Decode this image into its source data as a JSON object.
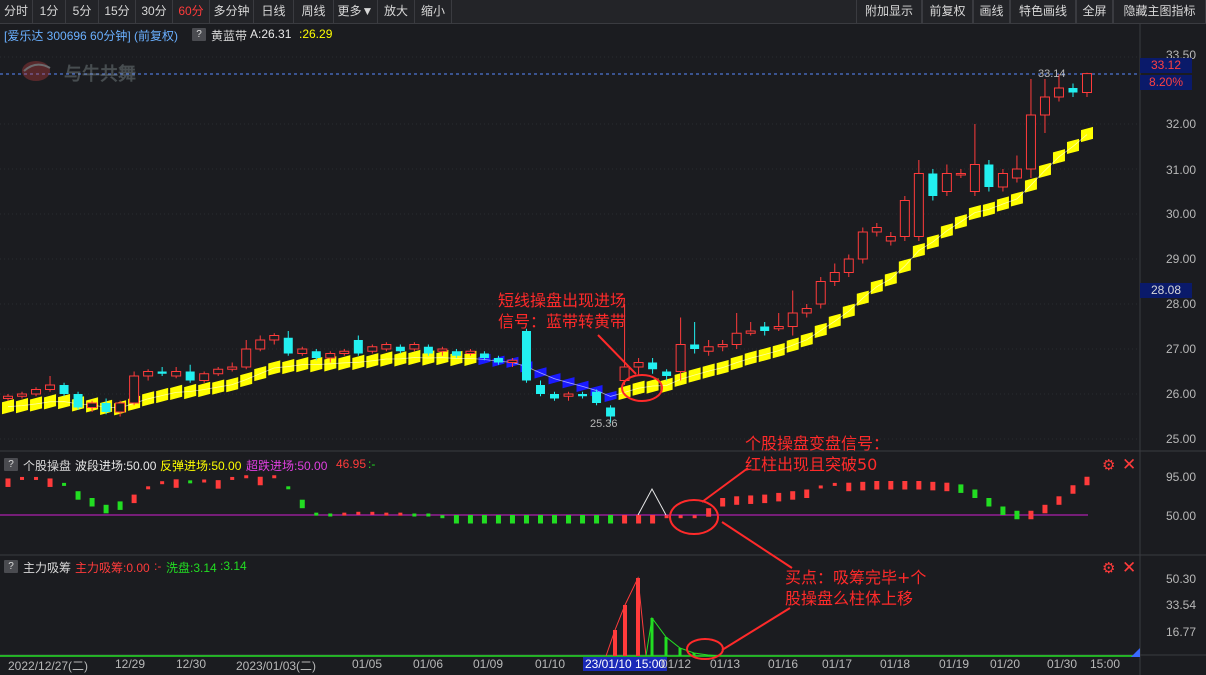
{
  "toolbar": {
    "left": [
      "分时",
      "1分",
      "5分",
      "15分",
      "30分",
      "60分",
      "多分钟",
      "日线",
      "周线",
      "更多▼",
      "放大",
      "缩小"
    ],
    "right": [
      "附加显示",
      "前复权",
      "画线",
      "特色画线",
      "全屏",
      "隐藏主图指标"
    ]
  },
  "main": {
    "title": "[爱乐达 300696 60分钟] (前复权)",
    "indicator_name": "黄蓝带",
    "indicator_a": "A:26.31",
    "indicator_b": ":26.29",
    "watermark": "与牛共舞",
    "price_axis": [
      "33.50",
      "32.00",
      "31.00",
      "30.00",
      "29.00",
      "28.00",
      "27.00",
      "26.00",
      "25.00"
    ],
    "current_price": "33.12",
    "current_pct": "8.20%",
    "ref_price": "28.08",
    "high_label": "33.14",
    "low_label": "25.36"
  },
  "sub1": {
    "name": "个股操盘",
    "v1": "波段进场:50.00",
    "v2": "反弹进场:50.00",
    "v3": "超跌进场:50.00",
    "v4": "46.95",
    "v5": ":-",
    "axis": [
      "95.00",
      "50.00"
    ]
  },
  "sub2": {
    "name": "主力吸筹",
    "v1": "主力吸筹:0.00",
    "v2": ":-",
    "v3": "洗盘:3.14",
    "v4": ":3.14",
    "axis": [
      "50.30",
      "33.54",
      "16.77"
    ]
  },
  "dates": [
    "2022/12/27(二)",
    "12/29",
    "12/30",
    "2023/01/03(二)",
    "01/05",
    "01/06",
    "01/09",
    "01/10",
    "23/01/10 15:00",
    "01/12",
    "01/13",
    "01/16",
    "01/17",
    "01/18",
    "01/19",
    "01/20",
    "01/30",
    "15:00"
  ],
  "annotations": {
    "a1_line1": "短线操盘出现进场",
    "a1_line2": "信号：蓝带转黄带",
    "a2_line1": "个股操盘变盘信号：",
    "a2_line2": "红柱出现且突破50",
    "a3_line1": "买点：吸筹完毕+个",
    "a3_line2": "股操盘么柱体上移"
  },
  "colors": {
    "up": "#ff3b3b",
    "down": "#22f0f0",
    "yellow": "#ffff00",
    "blue": "#1a1aff",
    "green": "#22dd22",
    "magenta": "#d020d0"
  },
  "chart_data": {
    "type": "candlestick",
    "series": [
      {
        "name": "K线",
        "ohlc": [
          [
            25.9,
            25.95,
            25.85,
            26.0
          ],
          [
            25.95,
            26.0,
            25.9,
            26.05
          ],
          [
            26.0,
            26.1,
            25.95,
            26.15
          ],
          [
            26.1,
            26.2,
            26.05,
            26.4
          ],
          [
            26.2,
            26.0,
            25.95,
            26.25
          ],
          [
            26.0,
            25.7,
            25.65,
            26.05
          ],
          [
            25.7,
            25.8,
            25.6,
            25.85
          ],
          [
            25.8,
            25.6,
            25.55,
            25.9
          ],
          [
            25.6,
            25.8,
            25.5,
            25.85
          ],
          [
            25.8,
            26.4,
            25.75,
            26.5
          ],
          [
            26.4,
            26.5,
            26.3,
            26.55
          ],
          [
            26.5,
            26.45,
            26.4,
            26.6
          ],
          [
            26.4,
            26.5,
            26.35,
            26.6
          ],
          [
            26.5,
            26.3,
            26.25,
            26.65
          ],
          [
            26.3,
            26.45,
            26.25,
            26.5
          ],
          [
            26.45,
            26.55,
            26.4,
            26.6
          ],
          [
            26.55,
            26.6,
            26.5,
            26.7
          ],
          [
            26.6,
            27.0,
            26.55,
            27.2
          ],
          [
            27.0,
            27.2,
            26.95,
            27.3
          ],
          [
            27.2,
            27.3,
            27.1,
            27.35
          ],
          [
            27.25,
            26.9,
            26.85,
            27.4
          ],
          [
            26.9,
            27.0,
            26.85,
            27.05
          ],
          [
            26.95,
            26.8,
            26.75,
            27.0
          ],
          [
            26.8,
            26.9,
            26.7,
            26.95
          ],
          [
            26.9,
            26.95,
            26.85,
            27.0
          ],
          [
            27.2,
            26.9,
            26.85,
            27.3
          ],
          [
            26.95,
            27.05,
            26.9,
            27.1
          ],
          [
            27.0,
            27.1,
            26.95,
            27.15
          ],
          [
            27.05,
            26.95,
            26.9,
            27.1
          ],
          [
            27.0,
            27.1,
            26.95,
            27.15
          ],
          [
            27.05,
            26.9,
            26.85,
            27.1
          ],
          [
            26.95,
            27.0,
            26.85,
            27.05
          ],
          [
            26.95,
            26.85,
            26.8,
            27.0
          ],
          [
            26.9,
            26.95,
            26.85,
            27.0
          ],
          [
            26.9,
            26.8,
            26.75,
            26.95
          ],
          [
            26.8,
            26.7,
            26.65,
            26.85
          ],
          [
            26.7,
            26.75,
            26.6,
            26.8
          ],
          [
            27.4,
            26.3,
            26.25,
            27.45
          ],
          [
            26.2,
            26.0,
            25.95,
            26.3
          ],
          [
            26.0,
            25.9,
            25.85,
            26.05
          ],
          [
            25.95,
            26.0,
            25.85,
            26.05
          ],
          [
            26.0,
            25.95,
            25.9,
            26.05
          ],
          [
            26.05,
            25.8,
            25.75,
            26.1
          ],
          [
            25.7,
            25.5,
            25.36,
            25.75
          ],
          [
            26.3,
            26.6,
            26.2,
            28.0
          ],
          [
            26.6,
            26.7,
            26.4,
            26.8
          ],
          [
            26.7,
            26.55,
            26.45,
            26.8
          ],
          [
            26.5,
            26.4,
            26.3,
            26.55
          ],
          [
            26.5,
            27.1,
            26.3,
            27.7
          ],
          [
            27.1,
            27.0,
            26.9,
            27.6
          ],
          [
            26.95,
            27.05,
            26.85,
            27.2
          ],
          [
            27.05,
            27.1,
            26.95,
            27.2
          ],
          [
            27.1,
            27.35,
            27.0,
            27.8
          ],
          [
            27.35,
            27.4,
            27.3,
            27.6
          ],
          [
            27.5,
            27.4,
            27.3,
            27.6
          ],
          [
            27.45,
            27.5,
            27.4,
            27.8
          ],
          [
            27.5,
            27.8,
            27.3,
            28.3
          ],
          [
            27.8,
            27.9,
            27.7,
            28.0
          ],
          [
            28.0,
            28.5,
            27.9,
            28.6
          ],
          [
            28.5,
            28.7,
            28.4,
            28.9
          ],
          [
            28.7,
            29.0,
            28.6,
            29.1
          ],
          [
            29.0,
            29.6,
            28.9,
            29.7
          ],
          [
            29.6,
            29.7,
            29.5,
            29.8
          ],
          [
            29.4,
            29.5,
            29.3,
            29.6
          ],
          [
            29.5,
            30.3,
            29.4,
            30.4
          ],
          [
            29.5,
            30.9,
            29.4,
            31.2
          ],
          [
            30.9,
            30.4,
            30.3,
            31.0
          ],
          [
            30.5,
            30.9,
            30.4,
            31.1
          ],
          [
            30.9,
            30.9,
            30.8,
            31.0
          ],
          [
            30.5,
            31.1,
            30.4,
            32.0
          ],
          [
            31.1,
            30.6,
            30.5,
            31.2
          ],
          [
            30.6,
            30.9,
            30.5,
            31.0
          ],
          [
            30.8,
            31.0,
            30.7,
            31.3
          ],
          [
            31.0,
            32.2,
            30.8,
            33.0
          ],
          [
            32.2,
            32.6,
            31.8,
            33.0
          ],
          [
            32.6,
            32.8,
            32.5,
            33.1
          ],
          [
            32.8,
            32.7,
            32.6,
            32.9
          ],
          [
            32.7,
            33.12,
            32.6,
            33.14
          ]
        ]
      }
    ]
  }
}
